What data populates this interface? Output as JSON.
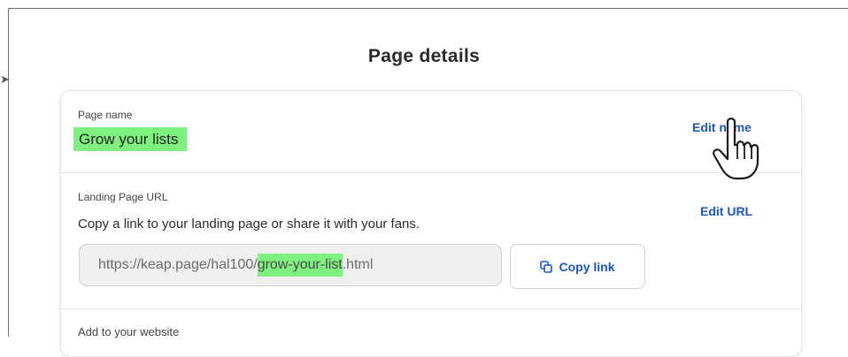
{
  "header": {
    "title": "Page details"
  },
  "page_name": {
    "label": "Page name",
    "value": "Grow your lists",
    "edit_label": "Edit name"
  },
  "landing_url": {
    "label": "Landing Page URL",
    "description": "Copy a link to your landing page or share it with your fans.",
    "edit_label": "Edit URL",
    "url_prefix": "https://keap.page/hal100/",
    "url_slug": "grow-your-list",
    "url_suffix": ".html",
    "copy_label": "Copy link"
  },
  "website": {
    "label": "Add to your website"
  },
  "colors": {
    "highlight": "#7ef07e",
    "link": "#1b56c7"
  },
  "icons": {
    "copy": "copy-icon",
    "cursor": "hand-pointer-icon"
  }
}
